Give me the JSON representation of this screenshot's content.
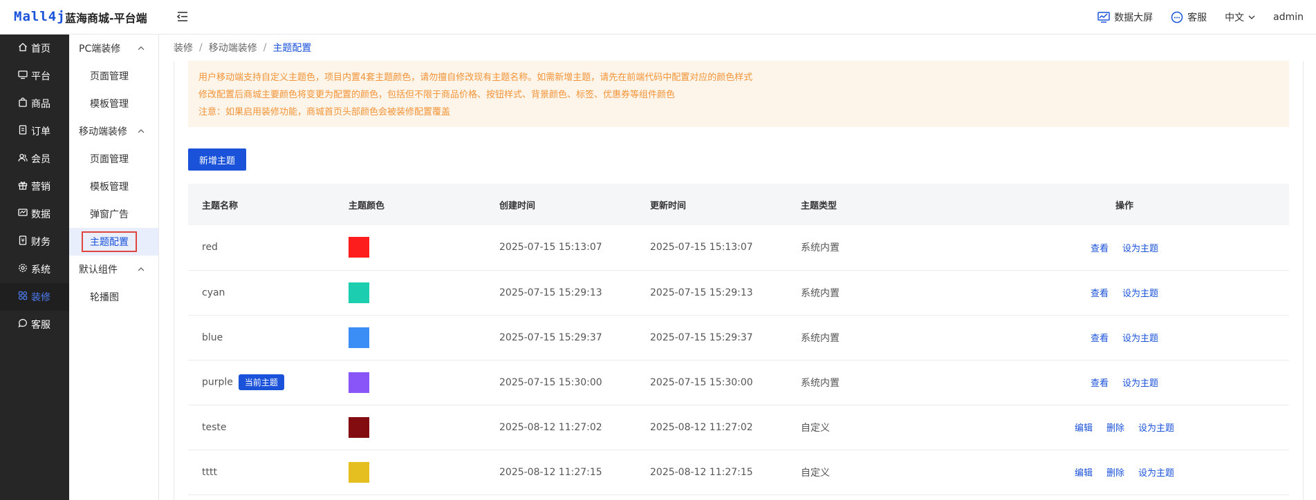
{
  "header": {
    "logo": "Mall4j",
    "title": "蓝海商城-平台端",
    "screen_label": "数据大屏",
    "service_label": "客服",
    "lang_label": "中文",
    "user_label": "admin"
  },
  "nav": {
    "items": [
      {
        "label": "首页",
        "icon": "home-icon"
      },
      {
        "label": "平台",
        "icon": "monitor-icon"
      },
      {
        "label": "商品",
        "icon": "bag-icon"
      },
      {
        "label": "订单",
        "icon": "document-icon"
      },
      {
        "label": "会员",
        "icon": "user-icon"
      },
      {
        "label": "营销",
        "icon": "gift-icon"
      },
      {
        "label": "数据",
        "icon": "chart-icon"
      },
      {
        "label": "财务",
        "icon": "finance-icon"
      },
      {
        "label": "系统",
        "icon": "gear-icon"
      },
      {
        "label": "装修",
        "icon": "brush-icon"
      },
      {
        "label": "客服",
        "icon": "chat-icon"
      }
    ],
    "active_index": 9
  },
  "subnav": {
    "groups": [
      {
        "label": "PC端装修",
        "items": [
          "页面管理",
          "模板管理"
        ]
      },
      {
        "label": "移动端装修",
        "items": [
          "页面管理",
          "模板管理",
          "弹窗广告",
          "主题配置"
        ]
      },
      {
        "label": "默认组件",
        "items": [
          "轮播图"
        ]
      }
    ],
    "active": "主题配置"
  },
  "breadcrumb": {
    "items": [
      "装修",
      "移动端装修",
      "主题配置"
    ],
    "separator": "/"
  },
  "notice": {
    "lines": [
      "用户移动端支持自定义主题色，项目内置4套主题颜色，请勿擅自修改现有主题名称。如需新增主题，请先在前端代码中配置对应的颜色样式",
      "修改配置后商城主要颜色将变更为配置的颜色，包括但不限于商品价格、按钮样式、背景颜色、标签、优惠券等组件颜色",
      "注意：如果启用装修功能，商城首页头部颜色会被装修配置覆盖"
    ]
  },
  "add_button": "新增主题",
  "table": {
    "columns": [
      "主题名称",
      "主题颜色",
      "创建时间",
      "更新时间",
      "主题类型",
      "操作"
    ],
    "current_badge": "当前主题",
    "rows": [
      {
        "name": "red",
        "color": "#fe1d1d",
        "created": "2025-07-15 15:13:07",
        "updated": "2025-07-15 15:13:07",
        "type": "系统内置",
        "ops": [
          "查看",
          "设为主题"
        ],
        "current": false
      },
      {
        "name": "cyan",
        "color": "#1cceaf",
        "created": "2025-07-15 15:29:13",
        "updated": "2025-07-15 15:29:13",
        "type": "系统内置",
        "ops": [
          "查看",
          "设为主题"
        ],
        "current": false
      },
      {
        "name": "blue",
        "color": "#3b8ef5",
        "created": "2025-07-15 15:29:37",
        "updated": "2025-07-15 15:29:37",
        "type": "系统内置",
        "ops": [
          "查看",
          "设为主题"
        ],
        "current": false
      },
      {
        "name": "purple",
        "color": "#8a55f8",
        "created": "2025-07-15 15:30:00",
        "updated": "2025-07-15 15:30:00",
        "type": "系统内置",
        "ops": [
          "查看",
          "设为主题"
        ],
        "current": true
      },
      {
        "name": "teste",
        "color": "#820c10",
        "created": "2025-08-12 11:27:02",
        "updated": "2025-08-12 11:27:02",
        "type": "自定义",
        "ops": [
          "编辑",
          "删除",
          "设为主题"
        ],
        "current": false
      },
      {
        "name": "tttt",
        "color": "#e5be1f",
        "created": "2025-08-12 11:27:15",
        "updated": "2025-08-12 11:27:15",
        "type": "自定义",
        "ops": [
          "编辑",
          "删除",
          "设为主题"
        ],
        "current": false
      }
    ]
  },
  "colors": {
    "accent": "#1a52d9",
    "nav_bg": "#262626",
    "notice_text": "#f29437",
    "notice_bg": "#fdf4ea"
  }
}
